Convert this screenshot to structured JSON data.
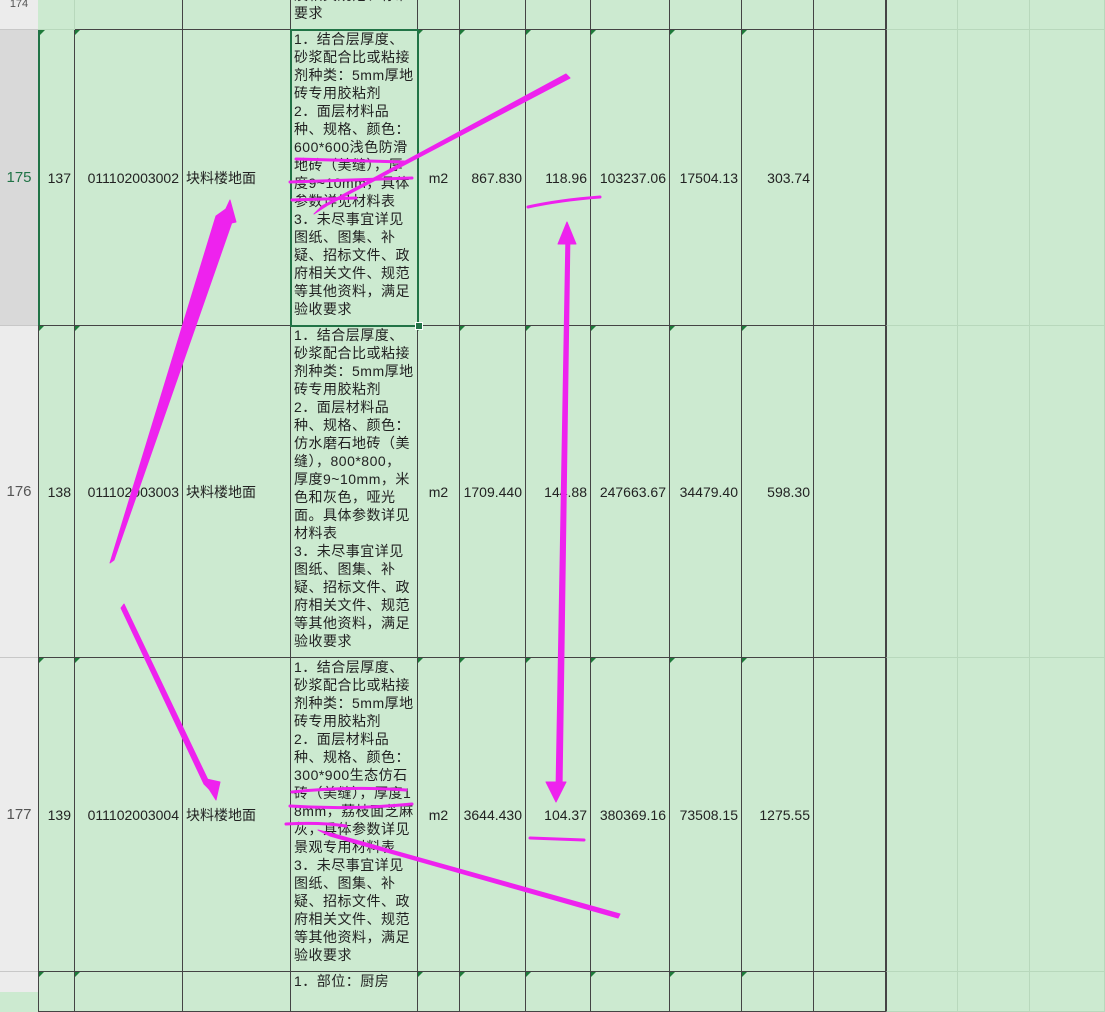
{
  "top_row": {
    "header": "174",
    "desc": "及相关规范、标准\n要求"
  },
  "rows": [
    {
      "header": "175",
      "seq": "137",
      "code": "011102003002",
      "name": "块料楼地面",
      "desc": "1．结合层厚度、砂浆配合比或粘接剂种类：5mm厚地砖专用胶粘剂\n2．面层材料品种、规格、颜色：600*600浅色防滑地砖（美缝），厚度9~10mm，具体参数详见材料表\n3．未尽事宜详见图纸、图集、补疑、招标文件、政府相关文件、规范等其他资料，满足验收要求",
      "unit": "m2",
      "qty": "867.830",
      "price": "118.96",
      "total": "103237.06",
      "c1": "17504.13",
      "c2": "303.74"
    },
    {
      "header": "176",
      "seq": "138",
      "code": "011102003003",
      "name": "块料楼地面",
      "desc": "1．结合层厚度、砂浆配合比或粘接剂种类：5mm厚地砖专用胶粘剂\n2．面层材料品种、规格、颜色：仿水磨石地砖（美缝），800*800，厚度9~10mm，米色和灰色，哑光面。具体参数详见材料表\n3．未尽事宜详见图纸、图集、补疑、招标文件、政府相关文件、规范等其他资料，满足验收要求",
      "unit": "m2",
      "qty": "1709.440",
      "price": "144.88",
      "total": "247663.67",
      "c1": "34479.40",
      "c2": "598.30"
    },
    {
      "header": "177",
      "seq": "139",
      "code": "011102003004",
      "name": "块料楼地面",
      "desc": "1．结合层厚度、砂浆配合比或粘接剂种类：5mm厚地砖专用胶粘剂\n2．面层材料品种、规格、颜色：300*900生态仿石砖（美缝），厚度18mm，荔枝面芝麻灰，具体参数详见景观专用材料表\n3．未尽事宜详见图纸、图集、补疑、招标文件、政府相关文件、规范等其他资料，满足验收要求",
      "unit": "m2",
      "qty": "3644.430",
      "price": "104.37",
      "total": "380369.16",
      "c1": "73508.15",
      "c2": "1275.55"
    }
  ],
  "bottom_row": {
    "desc": "1．部位：厨房"
  },
  "colors": {
    "sheet_bg": "#ccead0",
    "selection": "#217346",
    "annotation": "#ee22ee"
  }
}
